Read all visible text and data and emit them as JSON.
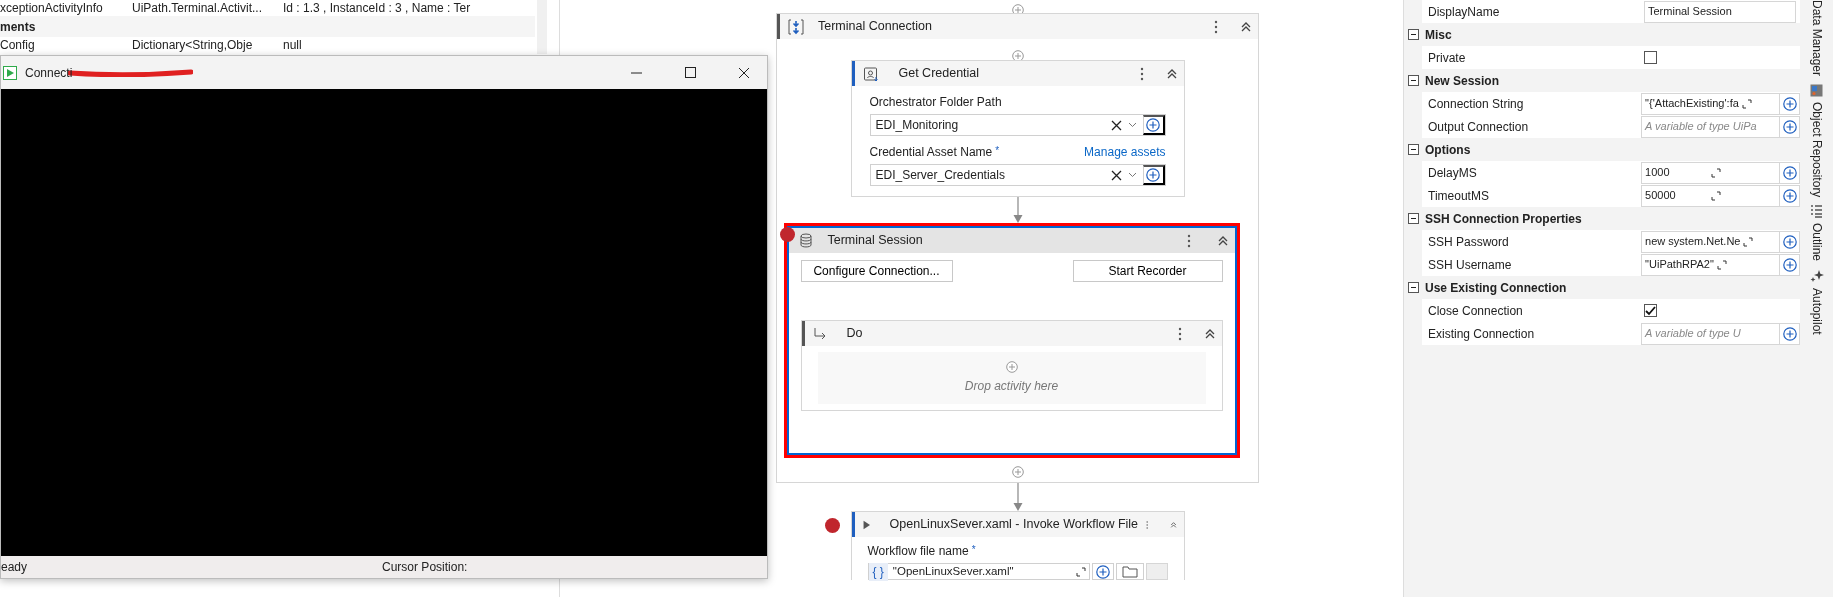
{
  "locals": {
    "rows": [
      {
        "kind": "value",
        "cells": [
          "xceptionActivityInfo",
          "UiPath.Terminal.Activit...",
          "Id : 1.3 , InstanceId : 3 , Name : Ter"
        ]
      },
      {
        "kind": "group",
        "cells": [
          "ments"
        ]
      },
      {
        "kind": "value",
        "cells": [
          "Config",
          "Dictionary<String,Obje",
          "null"
        ]
      }
    ]
  },
  "terminal_window": {
    "title": "Connecti",
    "status": "eady",
    "cursor_label": "Cursor Position:"
  },
  "designer": {
    "container": {
      "title": "Terminal Connection",
      "children": [
        {
          "kind": "credential",
          "title": "Get Credential",
          "selected": false,
          "breakpoint": false,
          "fields": [
            {
              "label": "Orchestrator Folder Path",
              "value": "EDI_Monitoring"
            },
            {
              "label": "Credential Asset Name",
              "mark": "*",
              "link": "Manage assets",
              "value": "EDI_Server_Credentials"
            }
          ]
        },
        {
          "kind": "session",
          "title": "Terminal Session",
          "selected": true,
          "breakpoint": true,
          "buttons": [
            "Configure Connection...",
            "Start Recorder"
          ],
          "body": {
            "title": "Do",
            "placeholder": "Drop activity here"
          }
        }
      ]
    },
    "next": {
      "title": "OpenLinuxSever.xaml - Invoke Workflow File",
      "breakpoint": true,
      "field": {
        "label": "Workflow file name",
        "mark": "*",
        "marker": "{ }",
        "value": "\"OpenLinuxSever.xaml\""
      }
    }
  },
  "properties": {
    "display_name": {
      "label": "DisplayName",
      "value": "Terminal Session"
    },
    "groups": [
      {
        "title": "Misc",
        "expanded": true,
        "rows": [
          {
            "kind": "checkbox",
            "label": "Private",
            "checked": false
          }
        ]
      },
      {
        "title": "New Session",
        "expanded": true,
        "rows": [
          {
            "kind": "expression",
            "label": "Connection String",
            "value": "\"{'AttachExisting':fa"
          },
          {
            "kind": "expression",
            "label": "Output Connection",
            "placeholder": "A variable of type UiPa"
          }
        ]
      },
      {
        "title": "Options",
        "expanded": true,
        "rows": [
          {
            "kind": "expression",
            "label": "DelayMS",
            "value": "1000"
          },
          {
            "kind": "expression",
            "label": "TimeoutMS",
            "value": "50000"
          }
        ]
      },
      {
        "title": "SSH Connection Properties",
        "expanded": true,
        "rows": [
          {
            "kind": "expression",
            "label": "SSH Password",
            "value": "new system.Net.Ne"
          },
          {
            "kind": "expression",
            "label": "SSH Username",
            "value": "\"UiPathRPA2\""
          }
        ]
      },
      {
        "title": "Use Existing Connection",
        "expanded": true,
        "rows": [
          {
            "kind": "checkbox",
            "label": "Close Connection",
            "checked": true
          },
          {
            "kind": "expression",
            "label": "Existing Connection",
            "placeholder": "A variable of type U"
          }
        ]
      }
    ]
  },
  "side_tabs": [
    {
      "kind": "plain",
      "label": "Data Manager"
    },
    {
      "kind": "repository",
      "label": "Object Repository"
    },
    {
      "kind": "outline",
      "label": "Outline"
    },
    {
      "kind": "autopilot",
      "label": "Autopilot"
    }
  ]
}
